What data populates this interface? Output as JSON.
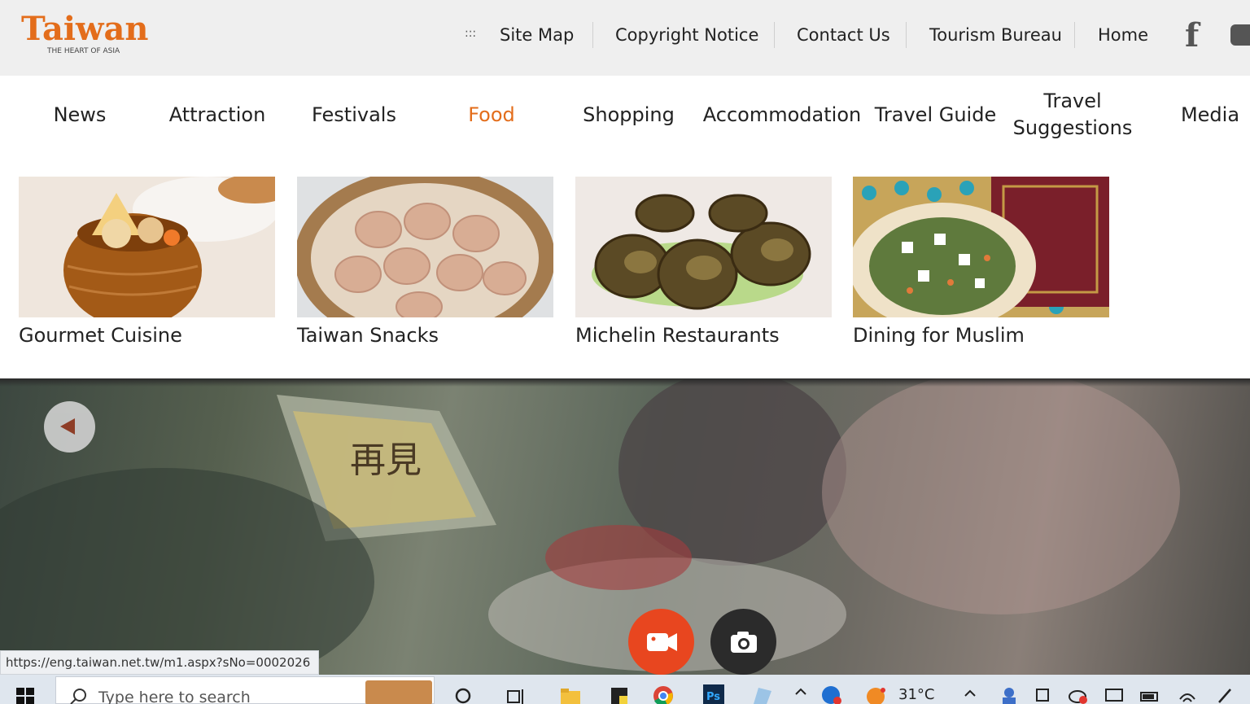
{
  "brand": {
    "name": "Taiwan",
    "tagline": "THE HEART OF ASIA",
    "color": "#e36d1b"
  },
  "utility_nav": {
    "menu_glyph": ":::",
    "items": [
      "Site Map",
      "Copyright Notice",
      "Contact Us",
      "Tourism Bureau",
      "Home"
    ],
    "social": [
      "facebook-icon",
      "youtube-icon"
    ]
  },
  "main_nav": {
    "items": [
      {
        "label": "News",
        "active": false
      },
      {
        "label": "Attraction",
        "active": false
      },
      {
        "label": "Festivals",
        "active": false
      },
      {
        "label": "Food",
        "active": true
      },
      {
        "label": "Shopping",
        "active": false
      },
      {
        "label": "Accommodation",
        "active": false
      },
      {
        "label": "Travel Guide",
        "active": false
      },
      {
        "label": "Travel Suggestions",
        "active": false
      },
      {
        "label": "Media",
        "active": false
      }
    ]
  },
  "food_menu": {
    "cards": [
      {
        "title": "Gourmet Cuisine",
        "image": "clay-pot-soup-photo"
      },
      {
        "title": "Taiwan Snacks",
        "image": "soup-dumplings-photo"
      },
      {
        "title": "Michelin Restaurants",
        "image": "abalone-dish-photo"
      },
      {
        "title": "Dining for Muslim",
        "image": "salad-plate-photo"
      }
    ]
  },
  "hero": {
    "controls": [
      "previous-slide",
      "record-video",
      "take-photo"
    ],
    "sign_text": "再見"
  },
  "status_url": "https://eng.taiwan.net.tw/m1.aspx?sNo=0002026",
  "taskbar": {
    "search_placeholder": "Type here to search",
    "temperature": "31°C"
  }
}
